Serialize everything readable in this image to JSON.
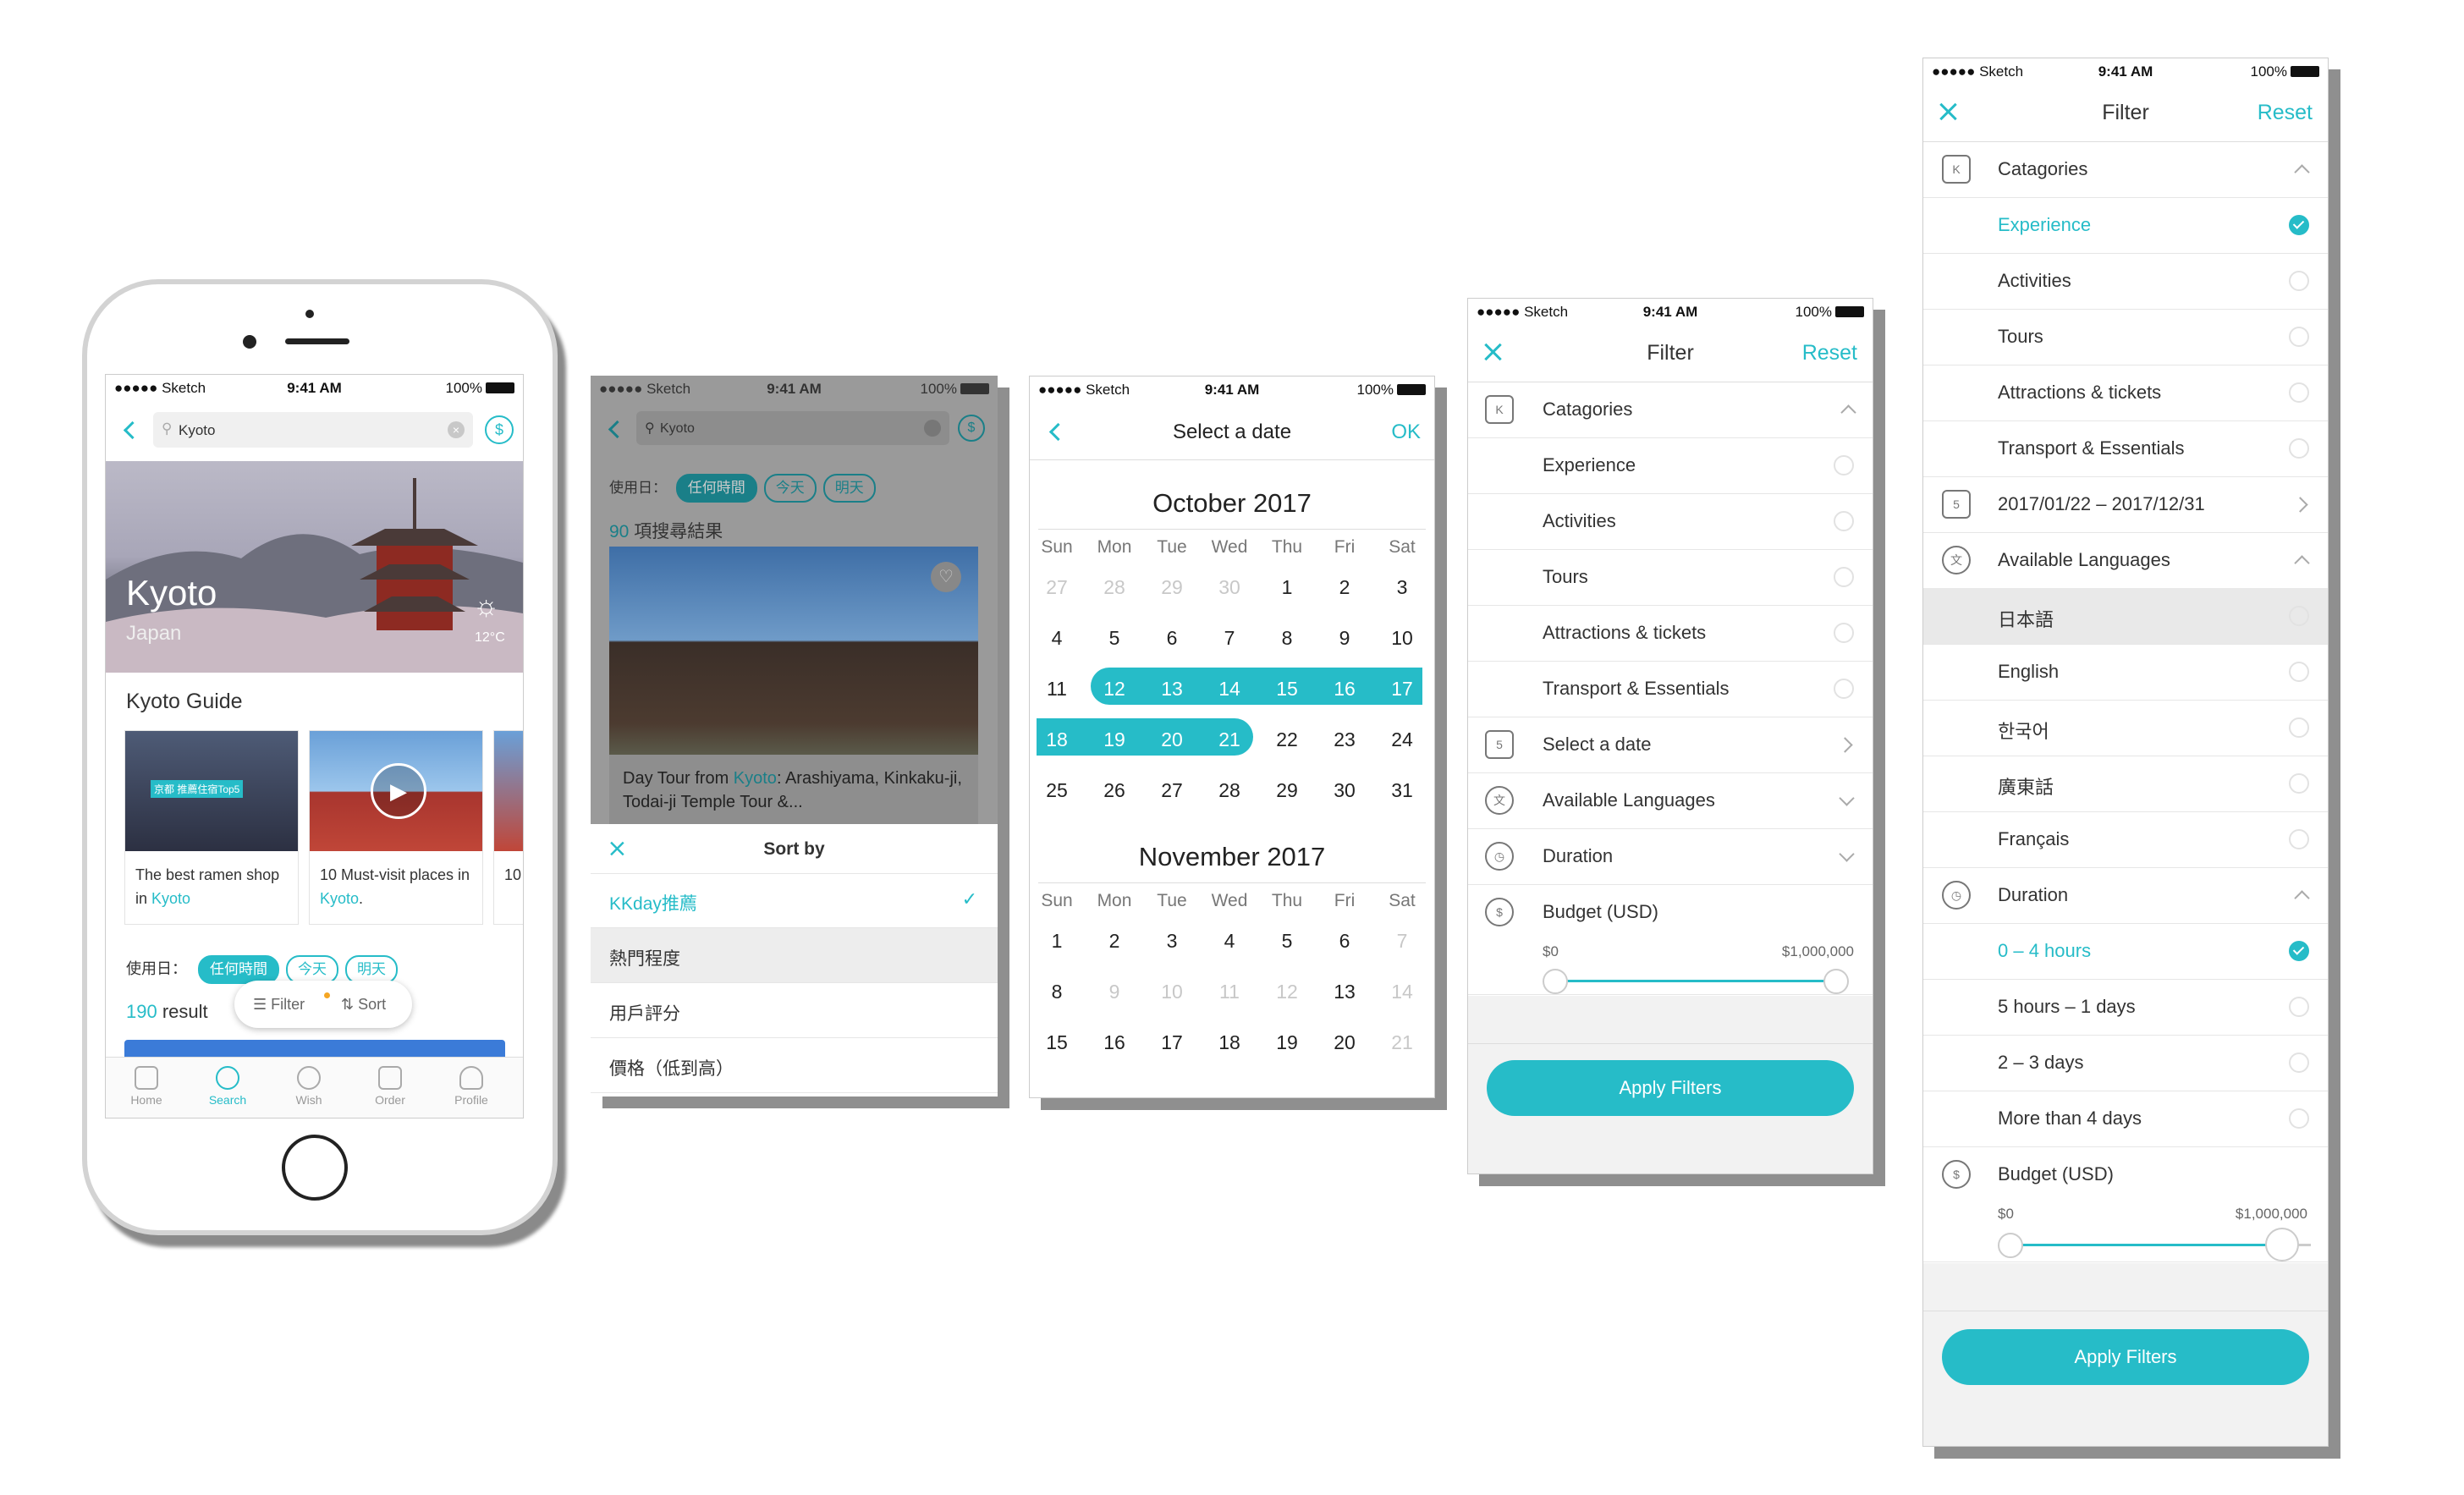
{
  "status_bar": {
    "carrier": "●●●●● Sketch",
    "wifi": "wifi-icon",
    "time": "9:41 AM",
    "battery": "100%"
  },
  "screen1": {
    "search_value": "Kyoto",
    "hero": {
      "city": "Kyoto",
      "country": "Japan",
      "weather_icon": "sun-icon",
      "temperature": "12°C"
    },
    "guide_title": "Kyoto Guide",
    "guide_cards": [
      {
        "badge": "京都  推薦住宿Top5",
        "text_before": "The best ramen shop in ",
        "link": "Kyoto",
        "text_after": ""
      },
      {
        "badge": "",
        "text_before": "10 Must-visit places in ",
        "link": "Kyoto",
        "text_after": "."
      },
      {
        "badge": "",
        "text_before": "10",
        "link": "",
        "text_after": ""
      }
    ],
    "date_label": "使用日：",
    "chips": [
      "任何時間",
      "今天",
      "明天"
    ],
    "results_count": "190",
    "results_text": " result",
    "filter_label": "Filter",
    "sort_label": "Sort",
    "tabs": [
      {
        "label": "Home",
        "icon": "home-icon"
      },
      {
        "label": "Search",
        "icon": "search-icon"
      },
      {
        "label": "Wish",
        "icon": "wish-icon"
      },
      {
        "label": "Order",
        "icon": "order-icon"
      },
      {
        "label": "Profile",
        "icon": "profile-icon"
      }
    ]
  },
  "screen2": {
    "search_value": "Kyoto",
    "date_label": "使用日：",
    "chips": [
      "任何時間",
      "今天",
      "明天"
    ],
    "results_count": "90",
    "results_text": " 項搜尋結果",
    "card_title_before": "Day Tour from ",
    "card_title_link": "Kyoto",
    "card_title_after": ": Arashiyama, Kinkaku-ji, Todai-ji Temple Tour &...",
    "sheet_title": "Sort by",
    "sort_options": [
      "KKday推薦",
      "熱門程度",
      "用戶評分",
      "價格（低到高）"
    ]
  },
  "screen3": {
    "title": "Select a date",
    "ok": "OK",
    "weekdays": [
      "Sun",
      "Mon",
      "Tue",
      "Wed",
      "Thu",
      "Fri",
      "Sat"
    ],
    "months": [
      {
        "name": "October 2017",
        "weeks": [
          [
            "27",
            "28",
            "29",
            "30",
            "1",
            "2",
            "3"
          ],
          [
            "4",
            "5",
            "6",
            "7",
            "8",
            "9",
            "10"
          ],
          [
            "11",
            "12",
            "13",
            "14",
            "15",
            "16",
            "17"
          ],
          [
            "18",
            "19",
            "20",
            "21",
            "22",
            "23",
            "24"
          ],
          [
            "25",
            "26",
            "27",
            "28",
            "29",
            "30",
            "31"
          ]
        ]
      },
      {
        "name": "November 2017",
        "weeks": [
          [
            "1",
            "2",
            "3",
            "4",
            "5",
            "6",
            "7"
          ],
          [
            "8",
            "9",
            "10",
            "11",
            "12",
            "13",
            "14"
          ],
          [
            "15",
            "16",
            "17",
            "18",
            "19",
            "20",
            "21"
          ]
        ]
      }
    ]
  },
  "screen4": {
    "title": "Filter",
    "reset": "Reset",
    "categories_label": "Catagories",
    "categories": [
      "Experience",
      "Activities",
      "Tours",
      "Attractions & tickets",
      "Transport & Essentials"
    ],
    "date_label": "Select a date",
    "languages_label": "Available Languages",
    "duration_label": "Duration",
    "budget_label": "Budget (USD)",
    "budget_min": "$0",
    "budget_max": "$1,000,000",
    "apply": "Apply Filters"
  },
  "screen5": {
    "title": "Filter",
    "reset": "Reset",
    "categories_label": "Catagories",
    "categories": [
      "Experience",
      "Activities",
      "Tours",
      "Attractions & tickets",
      "Transport & Essentials"
    ],
    "date_range": "2017/01/22 – 2017/12/31",
    "languages_label": "Available Languages",
    "languages": [
      "日本語",
      "English",
      "한국어",
      "廣東話",
      "Français"
    ],
    "duration_label": "Duration",
    "durations": [
      "0 – 4 hours",
      "5 hours – 1 days",
      "2 – 3 days",
      "More than 4 days"
    ],
    "budget_label": "Budget (USD)",
    "budget_min": "$0",
    "budget_max": "$1,000,000",
    "apply": "Apply Filters",
    "category_icon_letter": "K",
    "calendar_icon_number": "5"
  }
}
